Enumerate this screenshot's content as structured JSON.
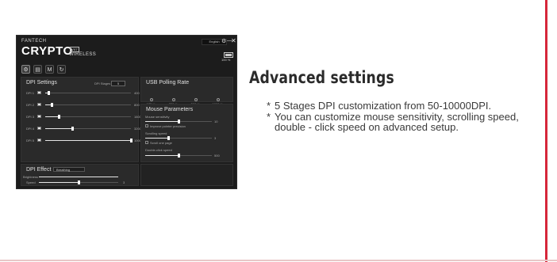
{
  "app": {
    "brand": "FANTECH",
    "product": "CRYPTO",
    "badge": "VX7",
    "subtitle": "WIRELESS",
    "language": "English",
    "battery": "100 %",
    "window_controls": {
      "settings": "⚙",
      "minimize": "—",
      "close": "✕"
    },
    "tabs": [
      {
        "icon": "gear-icon",
        "glyph": "⚙"
      },
      {
        "icon": "mouse-icon",
        "glyph": "▤"
      },
      {
        "icon": "macro-icon",
        "glyph": "M"
      },
      {
        "icon": "refresh-icon",
        "glyph": "↻"
      }
    ]
  },
  "dpi": {
    "title": "DPI Settings",
    "stages_label": "DPI Stages",
    "stages_value": "5",
    "rows": [
      {
        "label": "DPI 1",
        "value": "400",
        "fraction": 0.04,
        "color": "#e5e5e5"
      },
      {
        "label": "DPI 2",
        "value": "800",
        "fraction": 0.08,
        "color": "#e5e5e5"
      },
      {
        "label": "DPI 3",
        "value": "1600",
        "fraction": 0.16,
        "color": "#e5e5e5"
      },
      {
        "label": "DPI 4",
        "value": "3200",
        "fraction": 0.32,
        "color": "#e5e5e5"
      },
      {
        "label": "DPI 5",
        "value": "10000",
        "fraction": 1.0,
        "color": "#e5e5e5"
      }
    ]
  },
  "usb": {
    "title": "USB Polling Rate",
    "options": [
      "125 Hz",
      "250 Hz",
      "500 Hz",
      "1000 Hz"
    ]
  },
  "mouse_params": {
    "title": "Mouse Parameters",
    "sensitivity_label": "Mouse sensitivity",
    "sensitivity_value": "10",
    "sensitivity_fraction": 0.5,
    "precision_label": "Improve pointer precision",
    "scroll_label": "Scrolling speed",
    "scroll_value": "3",
    "scroll_fraction": 0.35,
    "scroll_page_label": "Scroll one page",
    "dblclick_label": "Double-click speed",
    "dblclick_value": "500",
    "dblclick_fraction": 0.5
  },
  "effect": {
    "title": "DPI Effect",
    "mode": "Breathing",
    "brightness_label": "Brightness",
    "brightness_fraction": 1.0,
    "speed_label": "Speed",
    "speed_value": "3",
    "speed_fraction": 0.5
  },
  "content": {
    "heading": "Advanced settings",
    "bullets": [
      "5 Stages DPI customization from 50-10000DPI.",
      "You can customize mouse sensitivity, scrolling speed, double - click speed on advanced setup."
    ]
  }
}
